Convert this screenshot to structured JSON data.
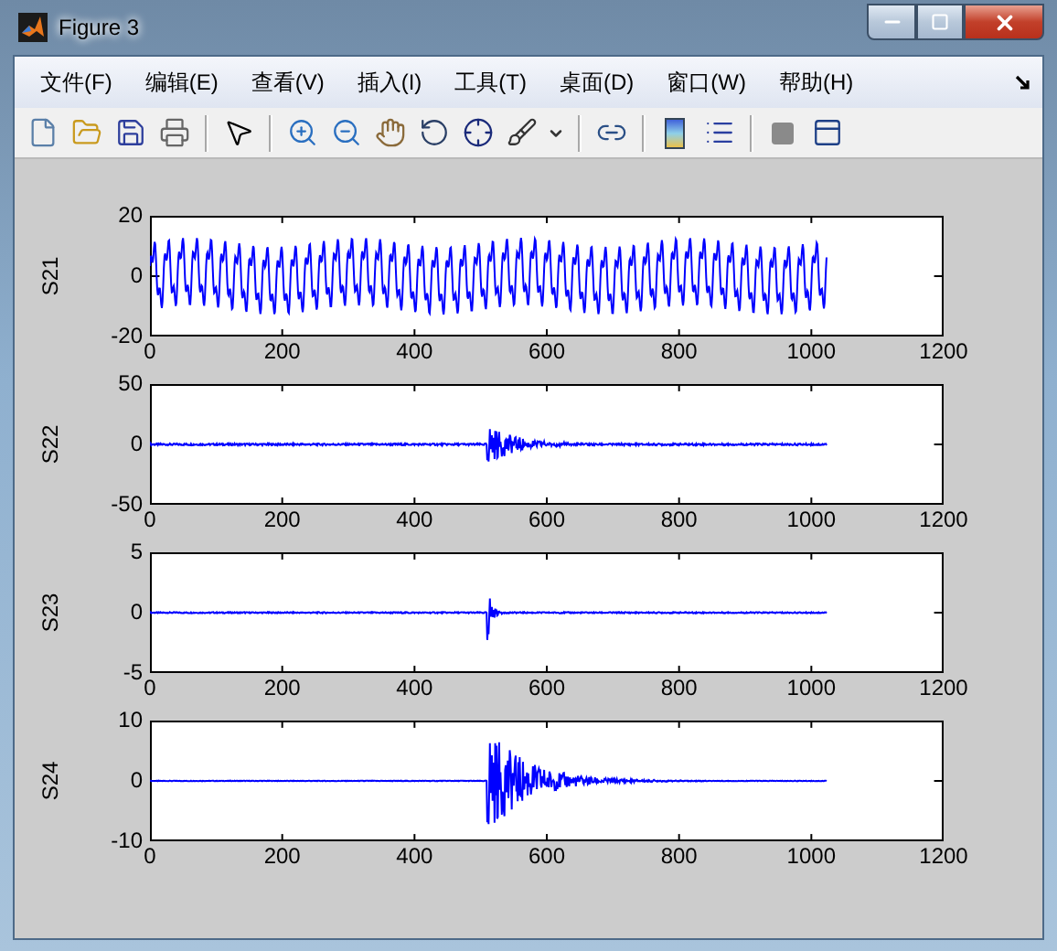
{
  "window": {
    "title": "Figure 3"
  },
  "menu": [
    "文件(F)",
    "编辑(E)",
    "查看(V)",
    "插入(I)",
    "工具(T)",
    "桌面(D)",
    "窗口(W)",
    "帮助(H)"
  ],
  "axes": [
    {
      "kind": "periodic",
      "ylabel": "S21",
      "yticks": [
        "20",
        "0",
        "-20"
      ],
      "xticks": [
        "0",
        "200",
        "400",
        "600",
        "800",
        "1000",
        "1200"
      ]
    },
    {
      "kind": "burst",
      "ylabel": "S22",
      "yticks": [
        "50",
        "0",
        "-50"
      ],
      "xticks": [
        "0",
        "200",
        "400",
        "600",
        "800",
        "1000",
        "1200"
      ]
    },
    {
      "kind": "burst",
      "ylabel": "S23",
      "yticks": [
        "5",
        "0",
        "-5"
      ],
      "xticks": [
        "0",
        "200",
        "400",
        "600",
        "800",
        "1000",
        "1200"
      ]
    },
    {
      "kind": "burst",
      "ylabel": "S24",
      "yticks": [
        "10",
        "0",
        "-10"
      ],
      "xticks": [
        "0",
        "200",
        "400",
        "600",
        "800",
        "1000",
        "1200"
      ]
    }
  ]
}
